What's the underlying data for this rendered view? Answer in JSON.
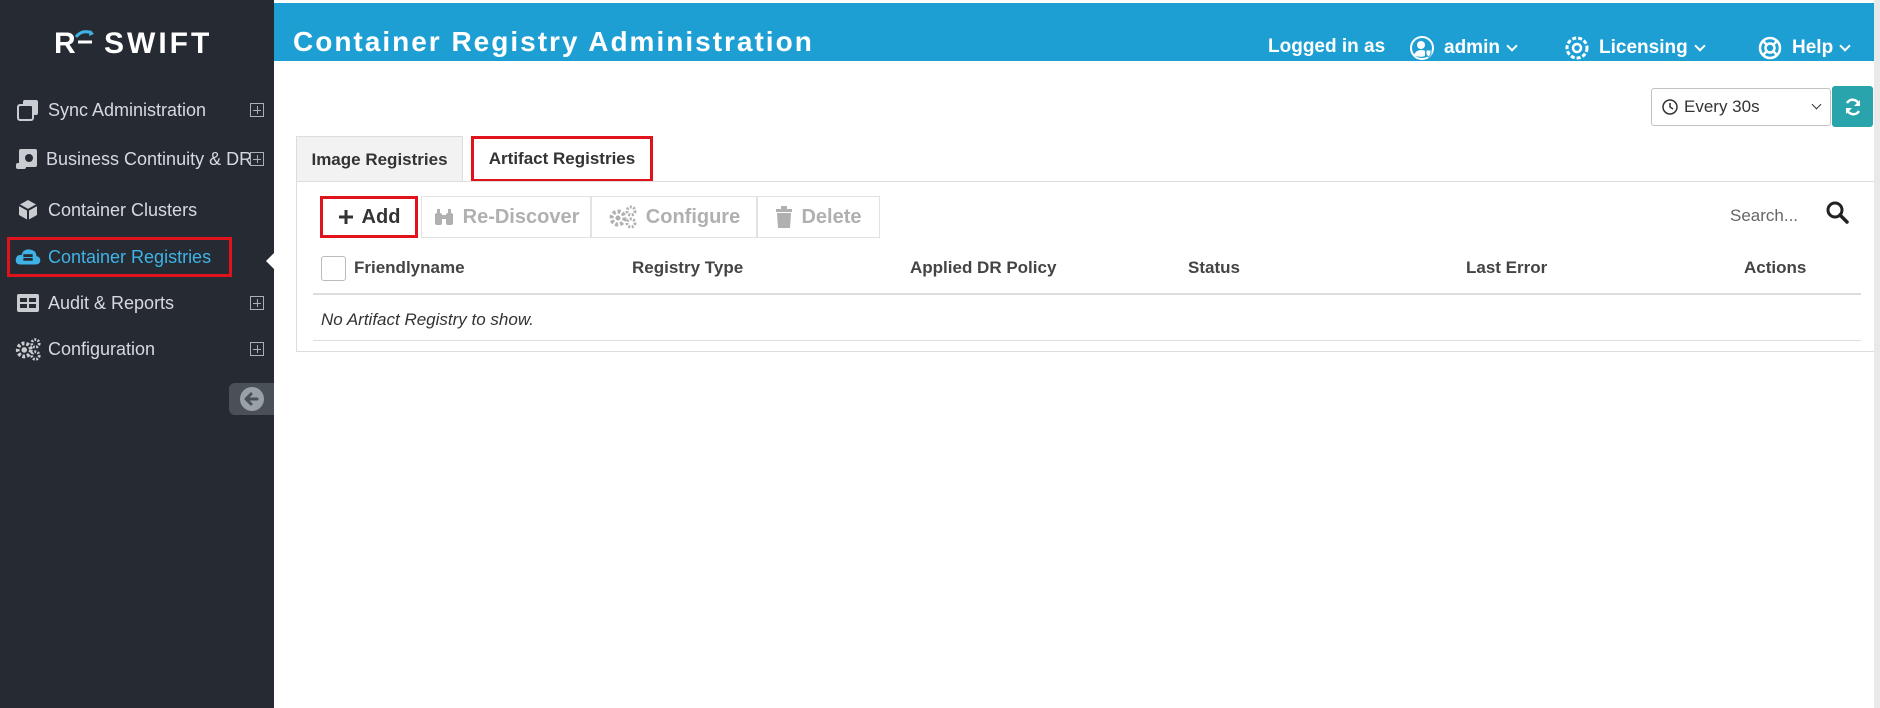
{
  "brand": {
    "logo_letter": "R",
    "name": "SWIFT"
  },
  "sidebar": {
    "items": [
      {
        "label": "Sync Administration",
        "icon": "copy-icon",
        "expandable": true
      },
      {
        "label": "Business Continuity & DR",
        "icon": "scroll-icon",
        "expandable": true
      },
      {
        "label": "Container Clusters",
        "icon": "cube-icon",
        "expandable": false
      },
      {
        "label": "Container Registries",
        "icon": "cloud-server-icon",
        "expandable": false,
        "active": true
      },
      {
        "label": "Audit & Reports",
        "icon": "table-icon",
        "expandable": true
      },
      {
        "label": "Configuration",
        "icon": "gears-icon",
        "expandable": true
      }
    ],
    "collapse_icon": "arrow-left-circle-icon"
  },
  "header": {
    "title": "Container Registry Administration",
    "logged_in_label": "Logged in as",
    "user": "admin",
    "licensing": "Licensing",
    "help": "Help"
  },
  "refresh": {
    "interval": "Every 30s"
  },
  "tabs": [
    {
      "label": "Image Registries",
      "active": false
    },
    {
      "label": "Artifact Registries",
      "active": true
    }
  ],
  "toolbar": {
    "add": "Add",
    "rediscover": "Re-Discover",
    "configure": "Configure",
    "delete": "Delete",
    "search_placeholder": "Search..."
  },
  "table": {
    "columns": [
      "Friendlyname",
      "Registry Type",
      "Applied DR Policy",
      "Status",
      "Last Error",
      "Actions"
    ],
    "empty_message": "No Artifact Registry to show."
  },
  "colors": {
    "sidebar_bg": "#262b33",
    "header_bg": "#1e9fd4",
    "active_link": "#3fb3e6",
    "highlight": "#e0121b",
    "refresh_button": "#2aa4ac"
  }
}
